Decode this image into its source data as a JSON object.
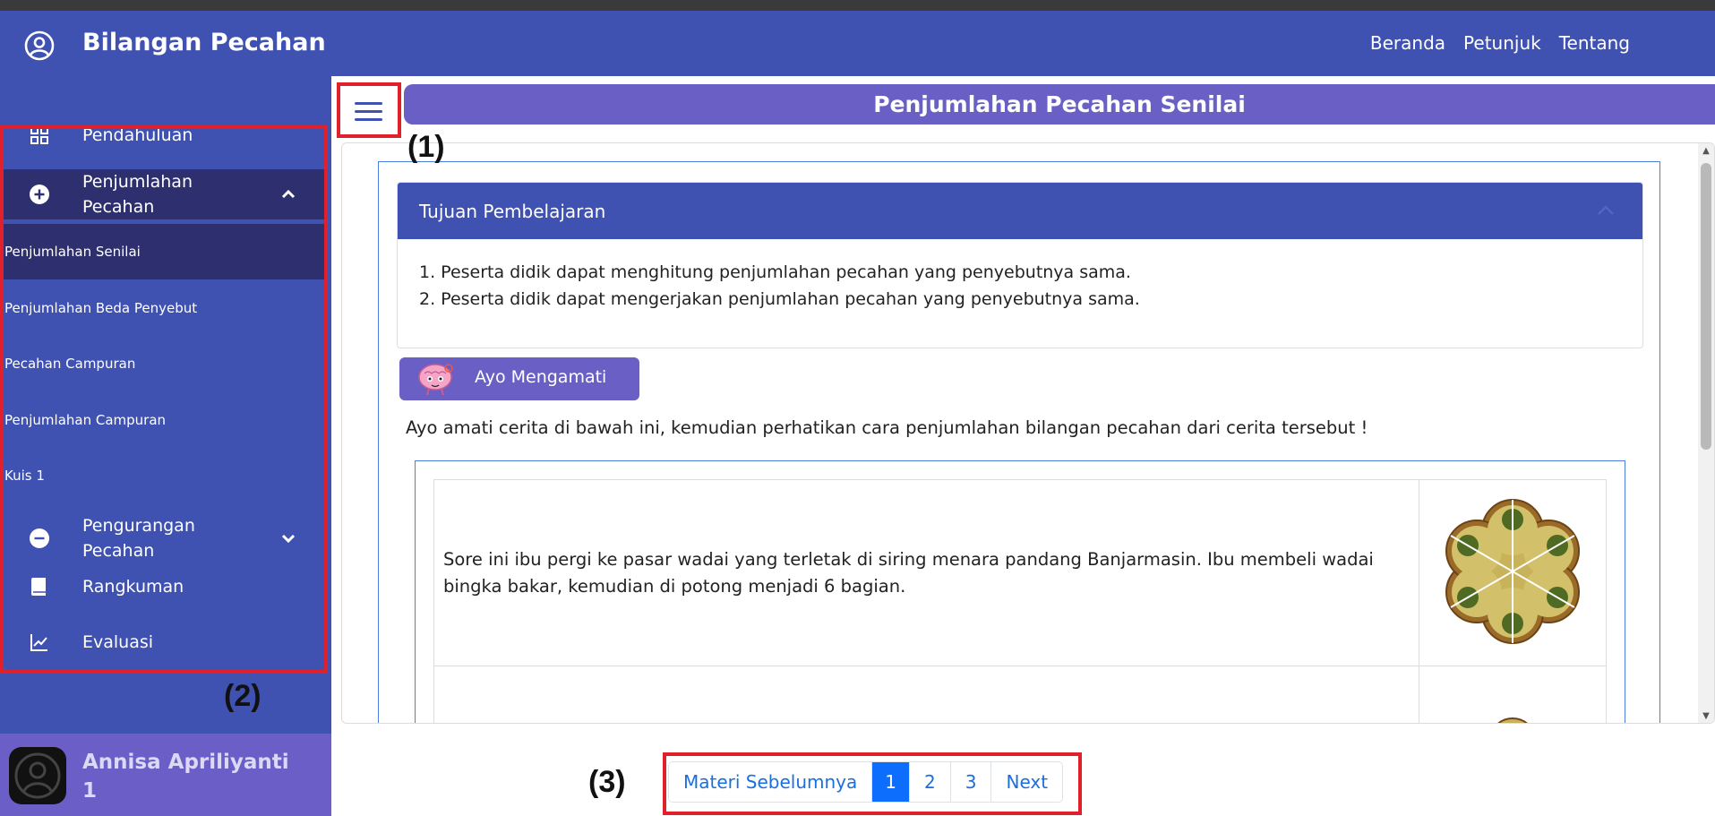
{
  "app": {
    "title": "Bilangan Pecahan",
    "icon": "user-circle-icon"
  },
  "topnav": [
    "Beranda",
    "Petunjuk",
    "Tentang"
  ],
  "sidebar": {
    "items": [
      {
        "label": "Pendahuluan",
        "icon": "grid-icon"
      },
      {
        "label": "Penjumlahan Pecahan",
        "label_line1": "Penjumlahan",
        "label_line2": "Pecahan",
        "icon": "plus-circle-icon",
        "expanded": true
      },
      {
        "label": "Pengurangan Pecahan",
        "label_line1": "Pengurangan",
        "label_line2": "Pecahan",
        "icon": "minus-circle-icon",
        "expanded": false
      },
      {
        "label": "Rangkuman",
        "icon": "book-icon"
      },
      {
        "label": "Evaluasi",
        "icon": "chart-line-icon"
      }
    ],
    "subitems": [
      {
        "label": "Penjumlahan Senilai",
        "active": true
      },
      {
        "label": "Penjumlahan Beda Penyebut"
      },
      {
        "label": "Pecahan Campuran"
      },
      {
        "label": "Penjumlahan Campuran"
      },
      {
        "label": "Kuis 1"
      }
    ]
  },
  "user": {
    "name_line1": "Annisa Apriliyanti",
    "name_line2": "1"
  },
  "page": {
    "title": "Penjumlahan Pecahan Senilai"
  },
  "objectives": {
    "heading": "Tujuan Pembelajaran",
    "items": [
      "1. Peserta didik dapat menghitung penjumlahan pecahan yang penyebutnya sama.",
      "2. Peserta didik dapat mengerjakan penjumlahan pecahan yang penyebutnya sama."
    ]
  },
  "observe": {
    "button_label": "Ayo Mengamati",
    "intro": "Ayo amati cerita di bawah ini, kemudian perhatikan cara penjumlahan bilangan pecahan dari cerita tersebut !",
    "story_line1": "Sore ini ibu pergi ke pasar wadai yang terletak di siring menara pandang Banjarmasin. Ibu membeli wadai",
    "story_line2": "bingka bakar, kemudian di potong menjadi 6 bagian."
  },
  "pagination": {
    "prev": "Materi Sebelumnya",
    "pages": [
      "1",
      "2",
      "3"
    ],
    "current": "1",
    "next": "Next"
  },
  "annotations": [
    "(1)",
    "(2)",
    "(3)"
  ],
  "colors": {
    "primary": "#3f51b1",
    "accent": "#6a5fc4",
    "active": "#2e2f6e",
    "annotation": "#e0202a",
    "page_active": "#0d6efd"
  }
}
